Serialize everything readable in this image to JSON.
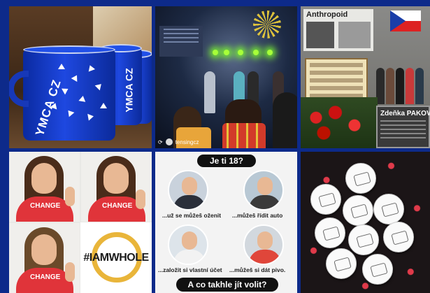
{
  "tiles": [
    {
      "id": "mugs",
      "mug_brand": "YMCA CZ"
    },
    {
      "id": "stage",
      "credit": "tensingcz"
    },
    {
      "id": "memorial",
      "poster_title": "Anthropoid",
      "plaque_name": "Zdeňka PAKOV"
    },
    {
      "id": "portraits",
      "shirt_text": "CHANGE",
      "hashtag": "#IAMWHOLE"
    },
    {
      "id": "voting",
      "header": "Je ti 18?",
      "captions": [
        "...už se můžeš oženit",
        "...můžeš řídit auto",
        "...založit si vlastní účet",
        "...můžeš si dát pivo."
      ],
      "footer": "A co takhle jít volit?"
    },
    {
      "id": "badges"
    }
  ],
  "colors": {
    "background": "#0d2a8a",
    "mug_blue": "#1e48e0",
    "shirt_red": "#e0343a",
    "ring_yellow": "#e9b53a",
    "heart_red": "#e03a4a"
  }
}
